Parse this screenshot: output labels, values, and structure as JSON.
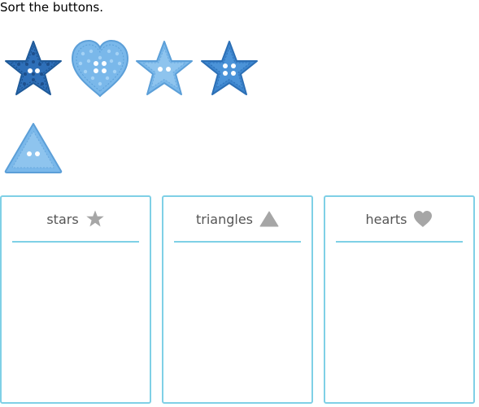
{
  "prompt": "Sort the buttons.",
  "pieces": [
    {
      "shape": "star",
      "style": "dark-blue-dotted",
      "holes": 2
    },
    {
      "shape": "heart",
      "style": "light-blue-dotted",
      "holes": 4
    },
    {
      "shape": "star",
      "style": "light-blue",
      "holes": 2
    },
    {
      "shape": "star",
      "style": "medium-blue",
      "holes": 4
    },
    {
      "shape": "triangle",
      "style": "light-blue",
      "holes": 2
    }
  ],
  "bins": [
    {
      "label": "stars",
      "icon": "star-icon"
    },
    {
      "label": "triangles",
      "icon": "triangle-icon"
    },
    {
      "label": "hearts",
      "icon": "heart-icon"
    }
  ],
  "colors": {
    "bin_border": "#7fd0e6",
    "bin_label": "#555555",
    "bin_icon": "#a6a6a6",
    "dark_blue": "#2e6fb8",
    "medium_blue": "#3d86cf",
    "light_blue": "#7ab8ea"
  }
}
